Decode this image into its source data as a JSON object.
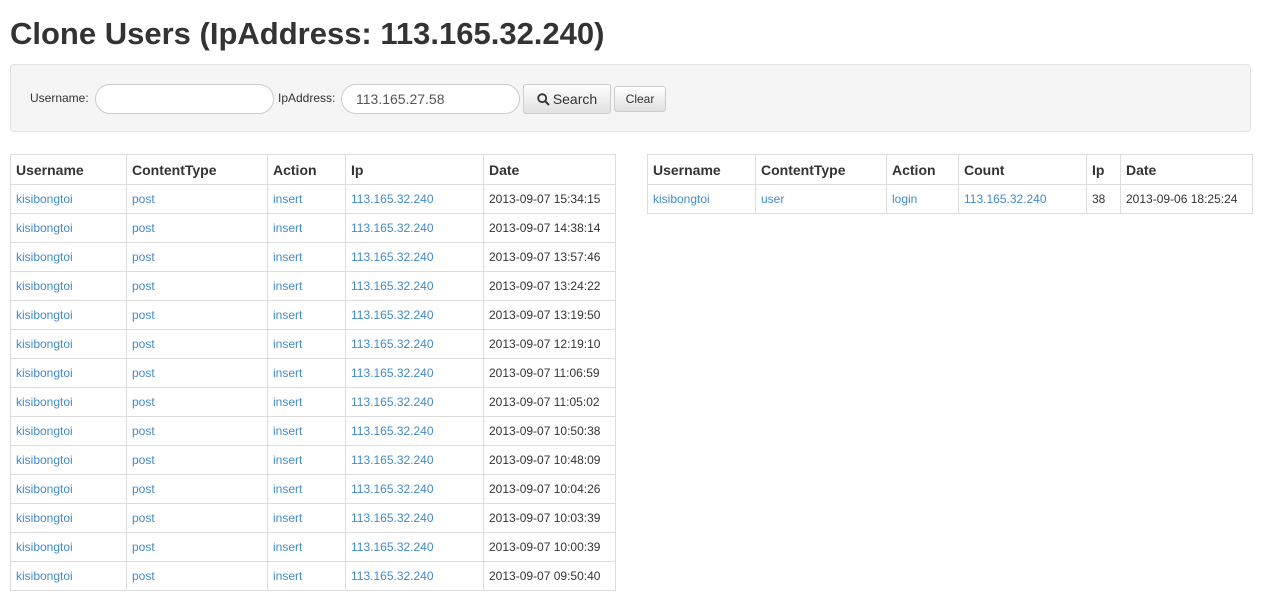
{
  "page": {
    "title": "Clone Users (IpAddress: 113.165.32.240)"
  },
  "search": {
    "username_label": "Username:",
    "username_value": "",
    "ip_label": "IpAddress:",
    "ip_value": "113.165.27.58",
    "search_button": "Search",
    "clear_button": "Clear"
  },
  "left_table": {
    "headers": [
      "Username",
      "ContentType",
      "Action",
      "Ip",
      "Date"
    ],
    "rows": [
      [
        "kisibongtoi",
        "post",
        "insert",
        "113.165.32.240",
        "2013-09-07 15:34:15"
      ],
      [
        "kisibongtoi",
        "post",
        "insert",
        "113.165.32.240",
        "2013-09-07 14:38:14"
      ],
      [
        "kisibongtoi",
        "post",
        "insert",
        "113.165.32.240",
        "2013-09-07 13:57:46"
      ],
      [
        "kisibongtoi",
        "post",
        "insert",
        "113.165.32.240",
        "2013-09-07 13:24:22"
      ],
      [
        "kisibongtoi",
        "post",
        "insert",
        "113.165.32.240",
        "2013-09-07 13:19:50"
      ],
      [
        "kisibongtoi",
        "post",
        "insert",
        "113.165.32.240",
        "2013-09-07 12:19:10"
      ],
      [
        "kisibongtoi",
        "post",
        "insert",
        "113.165.32.240",
        "2013-09-07 11:06:59"
      ],
      [
        "kisibongtoi",
        "post",
        "insert",
        "113.165.32.240",
        "2013-09-07 11:05:02"
      ],
      [
        "kisibongtoi",
        "post",
        "insert",
        "113.165.32.240",
        "2013-09-07 10:50:38"
      ],
      [
        "kisibongtoi",
        "post",
        "insert",
        "113.165.32.240",
        "2013-09-07 10:48:09"
      ],
      [
        "kisibongtoi",
        "post",
        "insert",
        "113.165.32.240",
        "2013-09-07 10:04:26"
      ],
      [
        "kisibongtoi",
        "post",
        "insert",
        "113.165.32.240",
        "2013-09-07 10:03:39"
      ],
      [
        "kisibongtoi",
        "post",
        "insert",
        "113.165.32.240",
        "2013-09-07 10:00:39"
      ],
      [
        "kisibongtoi",
        "post",
        "insert",
        "113.165.32.240",
        "2013-09-07 09:50:40"
      ]
    ]
  },
  "right_table": {
    "headers": [
      "Username",
      "ContentType",
      "Action",
      "Count",
      "Ip",
      "Date"
    ],
    "rows": [
      [
        "kisibongtoi",
        "user",
        "login",
        "113.165.32.240",
        "38",
        "2013-09-06 18:25:24"
      ]
    ]
  },
  "colors": {
    "link": "#428bca",
    "text": "#333333",
    "border": "#dddddd",
    "well": "#f5f5f5"
  },
  "icons": {
    "search": "search-icon"
  }
}
